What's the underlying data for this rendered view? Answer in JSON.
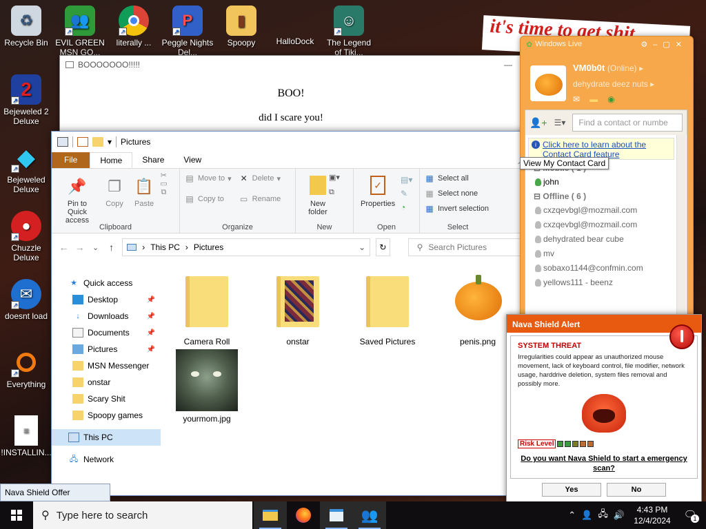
{
  "desktop": {
    "wallpaper_text": "it's time to get shit",
    "icons": [
      {
        "label": "Recycle Bin",
        "icon": "recycle-bin-icon"
      },
      {
        "label": "EVIL GREEN MSN GO...",
        "icon": "msn-people-icon"
      },
      {
        "label": "literally ...",
        "icon": "chrome-icon"
      },
      {
        "label": "Peggle Nights Del...",
        "icon": "peggle-icon"
      },
      {
        "label": "Spoopy",
        "icon": "folder-icon"
      },
      {
        "label": "HalloDock",
        "icon": "windows-logo-icon"
      },
      {
        "label": "The Legend of Tiki...",
        "icon": "game-character-icon"
      },
      {
        "label": "Bejeweled 2 Deluxe",
        "icon": "bejeweled2-icon"
      },
      {
        "label": "Bejeweled Deluxe",
        "icon": "diamond-icon"
      },
      {
        "label": "Chuzzle Deluxe",
        "icon": "chuzzle-icon"
      },
      {
        "label": "doesnt load",
        "icon": "thunderbird-icon"
      },
      {
        "label": "Everything",
        "icon": "magnifier-icon"
      },
      {
        "label": "!INSTALLIN...",
        "icon": "text-file-icon"
      }
    ]
  },
  "boo_window": {
    "title": "BOOOOOOO!!!!!",
    "line1": "BOO!",
    "line2": "did I scare you!"
  },
  "explorer": {
    "title": "Pictures",
    "tabs": {
      "file": "File",
      "home": "Home",
      "share": "Share",
      "view": "View"
    },
    "ribbon": {
      "pin": "Pin to Quick access",
      "copy": "Copy",
      "paste": "Paste",
      "clipboard": "Clipboard",
      "move_to": "Move to",
      "copy_to": "Copy to",
      "delete": "Delete",
      "rename": "Rename",
      "organize": "Organize",
      "new_folder": "New folder",
      "new": "New",
      "properties": "Properties",
      "open": "Open",
      "select_all": "Select all",
      "select_none": "Select none",
      "invert_selection": "Invert selection",
      "select": "Select"
    },
    "address": {
      "root": "This PC",
      "current": "Pictures"
    },
    "search_placeholder": "Search Pictures",
    "nav": {
      "quick_access": "Quick access",
      "items": [
        {
          "label": "Desktop",
          "pinned": true,
          "icon": "desktop-icon"
        },
        {
          "label": "Downloads",
          "pinned": true,
          "icon": "download-arrow-icon"
        },
        {
          "label": "Documents",
          "pinned": true,
          "icon": "documents-icon"
        },
        {
          "label": "Pictures",
          "pinned": true,
          "icon": "pictures-icon"
        },
        {
          "label": "MSN Messenger",
          "pinned": false,
          "icon": "folder-icon"
        },
        {
          "label": "onstar",
          "pinned": false,
          "icon": "folder-icon"
        },
        {
          "label": "Scary Shit",
          "pinned": false,
          "icon": "folder-icon"
        },
        {
          "label": "Spoopy games",
          "pinned": false,
          "icon": "folder-icon"
        }
      ],
      "this_pc": "This PC",
      "network": "Network"
    },
    "files": [
      {
        "name": "Camera Roll",
        "kind": "folder"
      },
      {
        "name": "onstar",
        "kind": "folder"
      },
      {
        "name": "Saved Pictures",
        "kind": "folder"
      },
      {
        "name": "penis.png",
        "kind": "image-pumpkin"
      },
      {
        "name": "yourmom.jpg",
        "kind": "image-face"
      }
    ]
  },
  "messenger": {
    "title": "Windows Live",
    "user": {
      "name": "VM0b0t",
      "status": "(Online)",
      "message": "dehydrate deez nuts"
    },
    "find_placeholder": "Find a contact or numbe",
    "notice": "Click here to learn about the Contact Card feature",
    "tooltip": "View My Contact Card",
    "groups": [
      {
        "label": "Mobile ( 1 )",
        "contacts": [
          {
            "name": "john",
            "online": true
          }
        ]
      },
      {
        "label": "Offline ( 6 )",
        "contacts": [
          {
            "name": "cxzqevbgl@mozmail.com",
            "online": false
          },
          {
            "name": "cxzqevbgl@mozmail.com",
            "online": false
          },
          {
            "name": "dehydrated bear cube",
            "online": false
          },
          {
            "name": "mv",
            "online": false
          },
          {
            "name": "sobaxo1144@confmin.com",
            "online": false
          },
          {
            "name": "yellows111 - beenz",
            "online": false
          }
        ]
      }
    ]
  },
  "nava": {
    "title": "Nava Shield Alert",
    "threat_heading": "SYSTEM THREAT",
    "description": "Irregularities could appear as unauthorized mouse movement, lack of keyboard control, file modifier, network usage, harddrive deletion, system files removal and possibly more.",
    "risk_label": "Risk Level",
    "risk_level": 5,
    "risk_max": 5,
    "question": "Do you want Nava Shield to start a emergency scan?",
    "yes": "Yes",
    "no": "No",
    "offer": "Nava Shield Offer"
  },
  "taskbar": {
    "search_placeholder": "Type here to search",
    "time": "4:43 PM",
    "date": "12/4/2024",
    "notification_count": "1",
    "apps": [
      "file-explorer-icon",
      "firefox-icon",
      "notepad-icon",
      "messenger-icon"
    ]
  },
  "colors": {
    "messenger_orange": "#f6a84a",
    "nava_header": "#e85a10",
    "file_tab": "#b0661b",
    "risk_green": "#3c9a3c",
    "risk_red": "#c0201e"
  }
}
